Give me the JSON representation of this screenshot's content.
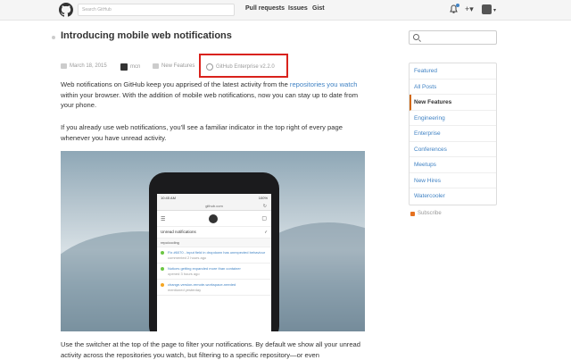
{
  "topbar": {
    "search_placeholder": "Search GitHub",
    "nav": [
      "Pull requests",
      "Issues",
      "Gist"
    ],
    "plus_icon": "+▾",
    "caret": "▾"
  },
  "post": {
    "title": "Introducing mobile web notifications",
    "date": "March 18, 2015",
    "author": "mcn",
    "category": "New Features",
    "tag": "GitHub Enterprise v2.2.0",
    "p1_a": "Web notifications on GitHub keep you apprised of the latest activity from the ",
    "p1_link": "repositories you watch",
    "p1_b": " within your browser. With the addition of mobile web notifications, now you can stay up to date from your phone.",
    "p2": "If you already use web notifications, you'll see a familiar indicator in the top right of every page whenever you have unread activity.",
    "p3": "Use the switcher at the top of the page to filter your notifications. By default we show all your unread activity across the repositories you watch, but filtering to a specific repository—or even"
  },
  "phone": {
    "time": "10:45 AM",
    "battery": "100%",
    "url": "github.com",
    "refresh": "↻",
    "unread_label": "Unread notifications",
    "check": "✓",
    "repo_label": "repo/coding",
    "items": [
      {
        "title": "Fix #6070 - input field in dropdown has unexpected behaviour",
        "sub": "commented 2 hours ago",
        "color": "#6cc644"
      },
      {
        "title": "Notices getting expanded more than container",
        "sub": "opened 3 hours ago",
        "color": "#6cc644"
      },
      {
        "title": "change-version-remote-workspace-needed",
        "sub": "mentioned yesterday",
        "color": "#f5a623"
      }
    ]
  },
  "sidebar": {
    "categories": [
      "Featured",
      "All Posts",
      "New Features",
      "Engineering",
      "Enterprise",
      "Conferences",
      "Meetups",
      "New Hires",
      "Watercooler"
    ],
    "active_index": 2,
    "subscribe": "Subscribe"
  },
  "colors": {
    "link": "#4183c4",
    "highlight": "#d9221c",
    "active_border": "#d26911"
  }
}
